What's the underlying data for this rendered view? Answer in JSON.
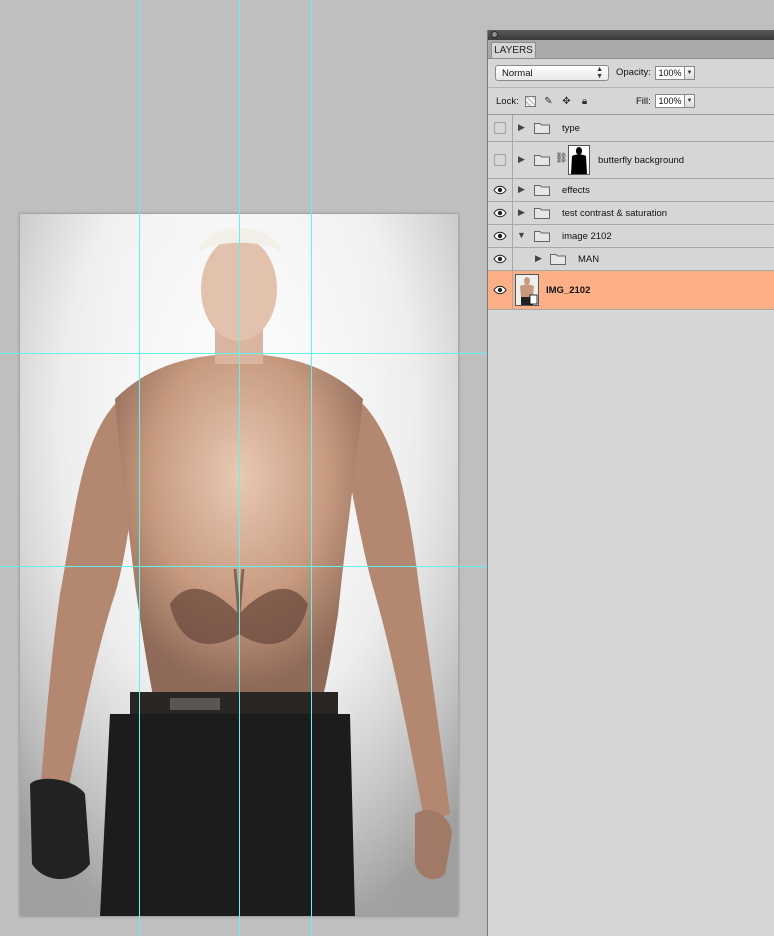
{
  "panel": {
    "tab_label": "LAYERS",
    "blend_mode": "Normal",
    "opacity_label": "Opacity:",
    "opacity_value": "100%",
    "lock_label": "Lock:",
    "fill_label": "Fill:",
    "fill_value": "100%",
    "lock_icons": [
      "lock-transparent-icon",
      "lock-brush-icon",
      "lock-move-icon",
      "lock-all-icon"
    ]
  },
  "layers": [
    {
      "name": "type",
      "visible": false,
      "kind": "group",
      "expanded": false
    },
    {
      "name": "butterfly background",
      "visible": false,
      "kind": "group-masked",
      "expanded": false
    },
    {
      "name": "effects",
      "visible": true,
      "kind": "group",
      "expanded": false
    },
    {
      "name": "test contrast & saturation",
      "visible": true,
      "kind": "group",
      "expanded": false
    },
    {
      "name": "image 2102",
      "visible": true,
      "kind": "group",
      "expanded": true
    },
    {
      "name": "MAN",
      "visible": true,
      "kind": "group",
      "expanded": false,
      "nested": true
    },
    {
      "name": "IMG_2102",
      "visible": true,
      "kind": "image",
      "selected": true
    }
  ],
  "colors": {
    "guide": "#5ff3f3",
    "selected_layer": "#fdb087",
    "workspace": "#bfbfbf"
  }
}
